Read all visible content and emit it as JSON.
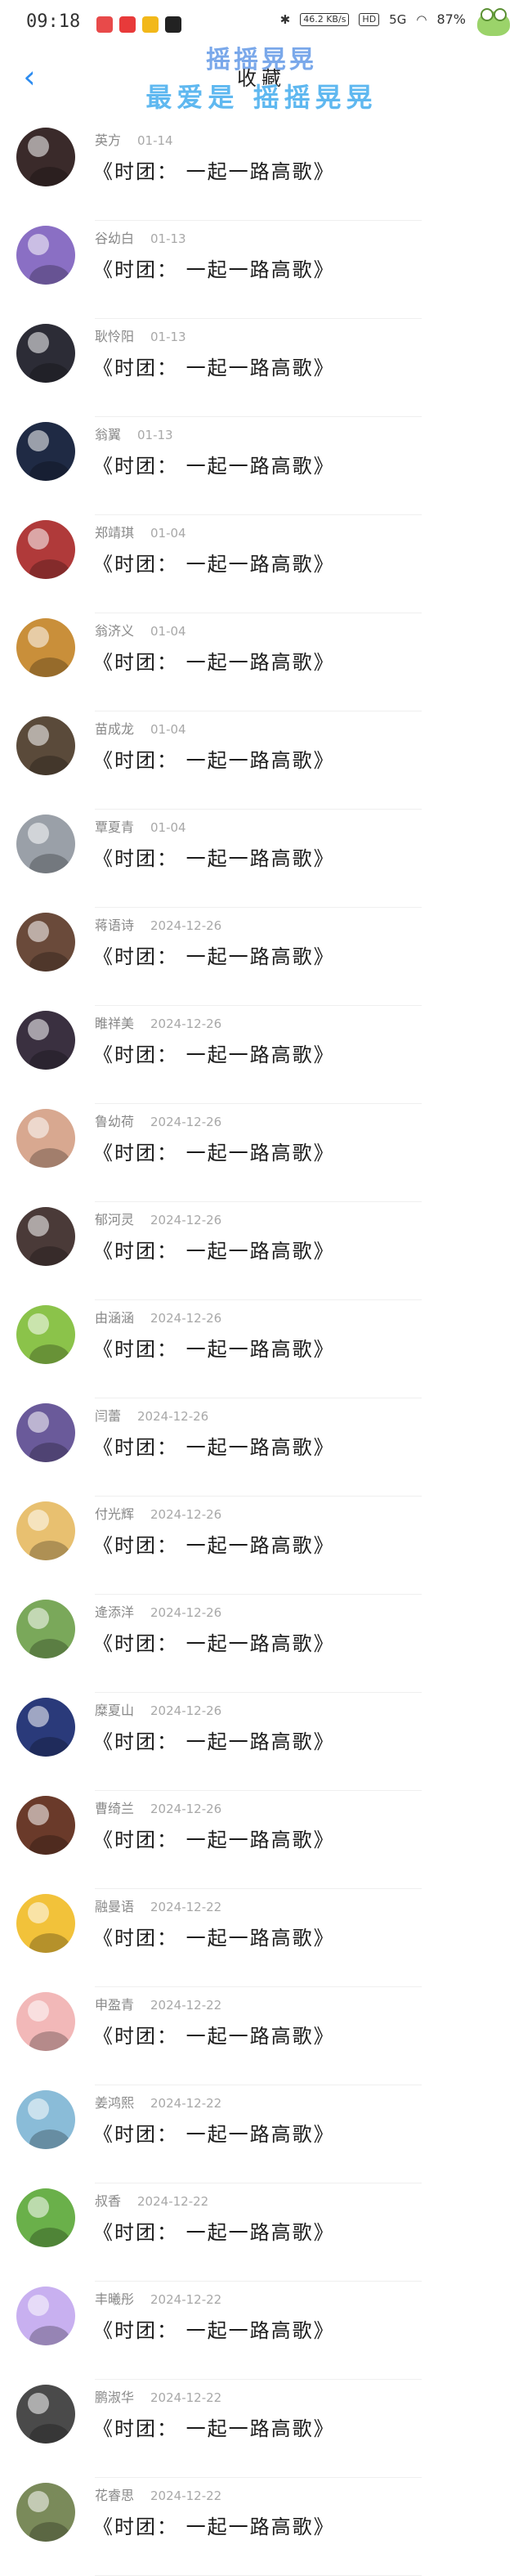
{
  "status": {
    "time": "09:18",
    "signal_label": "46.2 KB/s",
    "hd_label": "HD",
    "net_label": "5G",
    "battery": "87%"
  },
  "nav": {
    "title": "收藏",
    "watermark_line1": "摇摇晃晃",
    "watermark_line2": "最爱是 摇摇晃晃"
  },
  "items": [
    {
      "name": "英方",
      "date": "01-14",
      "song": "《时团： 一起一路高歌》",
      "color": "#3a2a2a"
    },
    {
      "name": "谷幼白",
      "date": "01-13",
      "song": "《时团： 一起一路高歌》",
      "color": "#8a6fc4"
    },
    {
      "name": "耿怜阳",
      "date": "01-13",
      "song": "《时团： 一起一路高歌》",
      "color": "#2c2c36"
    },
    {
      "name": "翁翼",
      "date": "01-13",
      "song": "《时团： 一起一路高歌》",
      "color": "#1f2a44"
    },
    {
      "name": "郑靖琪",
      "date": "01-04",
      "song": "《时团： 一起一路高歌》",
      "color": "#b03a3a"
    },
    {
      "name": "翁济义",
      "date": "01-04",
      "song": "《时团： 一起一路高歌》",
      "color": "#c98f3a"
    },
    {
      "name": "苗成龙",
      "date": "01-04",
      "song": "《时团： 一起一路高歌》",
      "color": "#5a4a3a"
    },
    {
      "name": "覃夏青",
      "date": "01-04",
      "song": "《时团： 一起一路高歌》",
      "color": "#9aa0a8"
    },
    {
      "name": "蒋语诗",
      "date": "2024-12-26",
      "song": "《时团： 一起一路高歌》",
      "color": "#6a4a3a"
    },
    {
      "name": "睢祥美",
      "date": "2024-12-26",
      "song": "《时团： 一起一路高歌》",
      "color": "#3a3040"
    },
    {
      "name": "鲁幼荷",
      "date": "2024-12-26",
      "song": "《时团： 一起一路高歌》",
      "color": "#d8a890"
    },
    {
      "name": "郁河灵",
      "date": "2024-12-26",
      "song": "《时团： 一起一路高歌》",
      "color": "#4a3a38"
    },
    {
      "name": "由涵涵",
      "date": "2024-12-26",
      "song": "《时团： 一起一路高歌》",
      "color": "#8bc34a"
    },
    {
      "name": "闫蕾",
      "date": "2024-12-26",
      "song": "《时团： 一起一路高歌》",
      "color": "#6a5a9a"
    },
    {
      "name": "付光辉",
      "date": "2024-12-26",
      "song": "《时团： 一起一路高歌》",
      "color": "#e8c070"
    },
    {
      "name": "逄添洋",
      "date": "2024-12-26",
      "song": "《时团： 一起一路高歌》",
      "color": "#7aa85a"
    },
    {
      "name": "糜夏山",
      "date": "2024-12-26",
      "song": "《时团： 一起一路高歌》",
      "color": "#2a3a7a"
    },
    {
      "name": "曹绮兰",
      "date": "2024-12-26",
      "song": "《时团： 一起一路高歌》",
      "color": "#6a3a2a"
    },
    {
      "name": "融曼语",
      "date": "2024-12-22",
      "song": "《时团： 一起一路高歌》",
      "color": "#f2c23a"
    },
    {
      "name": "申盈青",
      "date": "2024-12-22",
      "song": "《时团： 一起一路高歌》",
      "color": "#f2b8b8"
    },
    {
      "name": "姜鸿熙",
      "date": "2024-12-22",
      "song": "《时团： 一起一路高歌》",
      "color": "#8abcd8"
    },
    {
      "name": "叔香",
      "date": "2024-12-22",
      "song": "《时团： 一起一路高歌》",
      "color": "#6ab04a"
    },
    {
      "name": "丰曦彤",
      "date": "2024-12-22",
      "song": "《时团： 一起一路高歌》",
      "color": "#c8b0f0"
    },
    {
      "name": "鹏淑华",
      "date": "2024-12-22",
      "song": "《时团： 一起一路高歌》",
      "color": "#4a4a4a"
    },
    {
      "name": "花睿思",
      "date": "2024-12-22",
      "song": "《时团： 一起一路高歌》",
      "color": "#7a8a5a"
    }
  ]
}
